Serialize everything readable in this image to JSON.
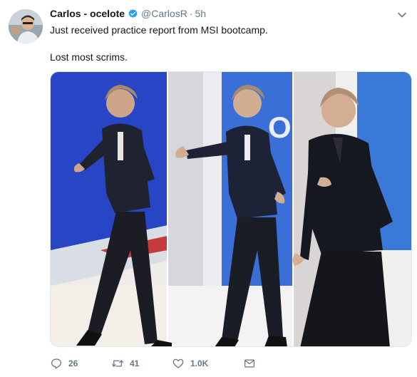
{
  "user": {
    "name": "Carlos - ocelote",
    "handle": "@CarlosR",
    "separator": "·",
    "time": "5h"
  },
  "tweet": {
    "line1": "Just received practice report from MSI bootcamp.",
    "line2": "Lost most scrims."
  },
  "media": {
    "sign_text": "OP"
  },
  "actions": {
    "replies": "26",
    "retweets": "41",
    "likes": "1.0K"
  },
  "icons": [
    "verified-icon",
    "caret-down-icon",
    "reply-icon",
    "retweet-icon",
    "like-icon",
    "dm-icon"
  ],
  "colors": {
    "verified": "#1da1f2",
    "muted": "#657786",
    "text": "#14171a",
    "stage_blue": "#1c3fb8"
  }
}
